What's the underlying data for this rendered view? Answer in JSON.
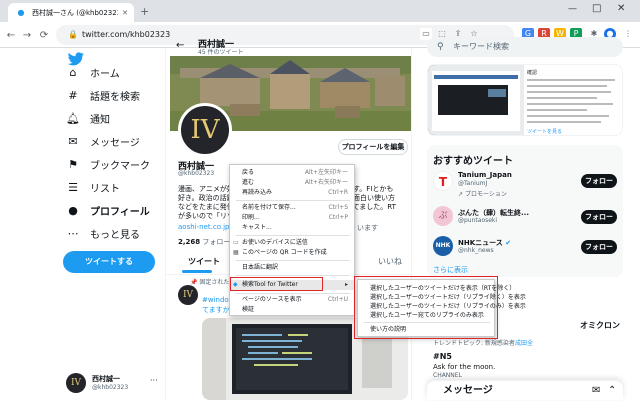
{
  "browser": {
    "tab_title": "西村誠一さん (@khb02323) / Tw",
    "url": "twitter.com/khb02323",
    "nav": {
      "back": "←",
      "forward": "→",
      "reload": "⟳"
    },
    "window_controls": {
      "minimize": "—",
      "maximize": "□",
      "close": "✕",
      "new_tab": "+"
    }
  },
  "twitter_logo": "twitter-bird",
  "sidebar": {
    "items": [
      {
        "label": "ホーム",
        "icon": "home-icon",
        "glyph": "⌂"
      },
      {
        "label": "話題を検索",
        "icon": "hashtag-icon",
        "glyph": "#"
      },
      {
        "label": "通知",
        "icon": "bell-icon",
        "glyph": "♫"
      },
      {
        "label": "メッセージ",
        "icon": "mail-icon",
        "glyph": "✉"
      },
      {
        "label": "ブックマーク",
        "icon": "bookmark-icon",
        "glyph": "⚑"
      },
      {
        "label": "リスト",
        "icon": "list-icon",
        "glyph": "☰"
      },
      {
        "label": "プロフィール",
        "icon": "person-icon",
        "glyph": "●"
      },
      {
        "label": "もっと見る",
        "icon": "more-icon",
        "glyph": "⋯"
      }
    ],
    "tweet_button": "ツイートする",
    "account": {
      "name": "西村誠一",
      "handle": "@khb02323",
      "avatar_text": "IV",
      "more": "···"
    }
  },
  "profile": {
    "header_name": "西村誠一",
    "header_count": "45 件のツイート",
    "back_arrow": "←",
    "avatar_text": "IV",
    "name": "西村誠一",
    "handle": "@khb02323",
    "bio_line1": "漫画、アニメが好",
    "bio_line1_tail": "です。FIとかも",
    "bio_line2": "好き。政治の話題",
    "bio_line2_tail": "の面白い使い方",
    "bio_line3": "などをたまに発信",
    "bio_line3_tail": "ってました。RT",
    "bio_line4": "が多いので「リツ",
    "link": "aoshi-net.co.jp/",
    "link_tail": "います",
    "follow_count": "2,268",
    "follow_label": "フォロー中",
    "edit_button": "プロフィールを編集",
    "tabs": [
      "ツイート",
      "いいね"
    ],
    "pinned_label": "固定されたツイート",
    "tweet_text1": "#windows",
    "tweet_text2": "てますか"
  },
  "context_menu": {
    "items": [
      {
        "label": "戻る",
        "shortcut": "Alt+左矢印キー"
      },
      {
        "label": "進む",
        "shortcut": "Alt+右矢印キー"
      },
      {
        "label": "再読み込み",
        "shortcut": "Ctrl+R"
      },
      {
        "label": "名前を付けて保存...",
        "shortcut": "Ctrl+S"
      },
      {
        "label": "印刷...",
        "shortcut": "Ctrl+P"
      },
      {
        "label": "キャスト...",
        "shortcut": ""
      },
      {
        "label": "お使いのデバイスに送信",
        "shortcut": ""
      },
      {
        "label": "このページの QR コードを作成",
        "shortcut": ""
      },
      {
        "label": "日本語に翻訳",
        "shortcut": ""
      },
      {
        "label": "検索Tool for Twitter",
        "shortcut": ""
      },
      {
        "label": "ページのソースを表示",
        "shortcut": "Ctrl+U"
      },
      {
        "label": "検証",
        "shortcut": ""
      }
    ],
    "submenu": [
      "選択したユーザーのツイートだけを表示（RTを除く）",
      "選択したユーザーのツイートだけ（リプライ除く）を表示",
      "選択したユーザーのツイートだけ（リプライのみ）を表示",
      "選択したユーザー宛てのリプライのみ表示",
      "使い方の説明"
    ]
  },
  "right": {
    "search_placeholder": "キーワード検索",
    "thumb_text1": "確認",
    "thumb_text2": "ツイートを見る",
    "recommend_title": "おすすめツイート",
    "users": [
      {
        "name": "Tanium_Japan",
        "handle": "@TaniumJ",
        "sub": "プロモーション",
        "avatar": "T",
        "color": "#e02020"
      },
      {
        "name": "ぷんた（肆）転生終...",
        "handle": "@puntaoseki",
        "sub": "",
        "avatar": "ぷ",
        "color": "#e9a9c0"
      },
      {
        "name": "NHKニュース",
        "handle": "@nhk_news",
        "sub": "",
        "avatar": "NHK",
        "color": "#1a5ea8"
      }
    ],
    "follow_label": "フォロー",
    "show_more": "さらに表示",
    "trend_tail": "オミクロン",
    "trend_line": "トレンドトピック: 新規感染者",
    "trend_line_tail": "成田全",
    "trend_n5": "#N5",
    "trend_ask": "Ask for the moon.",
    "trend_channel": "CHANNEL",
    "messages": "メッセージ"
  }
}
